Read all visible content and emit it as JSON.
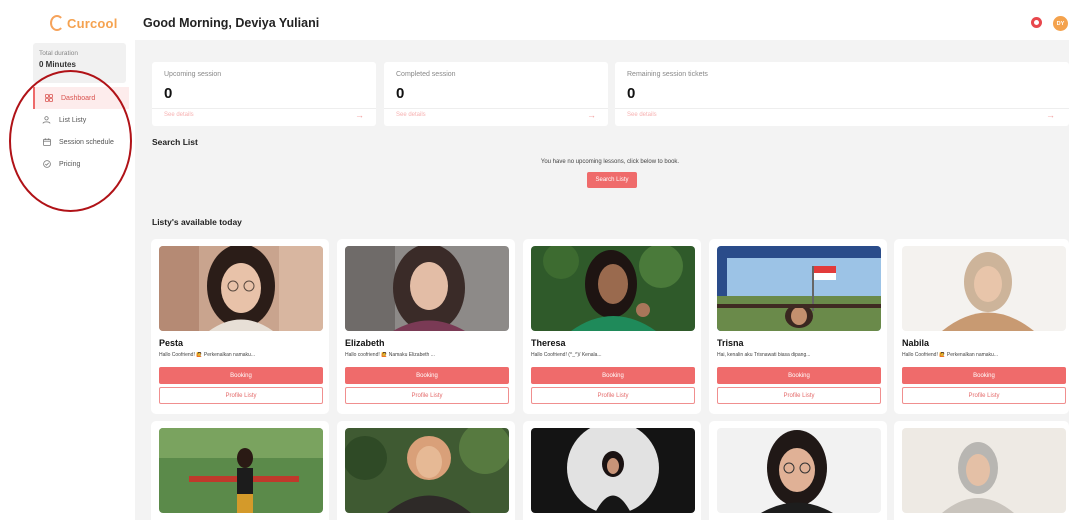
{
  "app": {
    "logo_text": "Curcool"
  },
  "sidebar": {
    "duration_label": "Total duration",
    "duration_value": "0 Minutes",
    "items": [
      {
        "label": "Dashboard",
        "icon": "grid-icon",
        "active": true
      },
      {
        "label": "List Listy",
        "icon": "users-icon",
        "active": false
      },
      {
        "label": "Session schedule",
        "icon": "calendar-icon",
        "active": false
      },
      {
        "label": "Pricing",
        "icon": "check-circle-icon",
        "active": false
      }
    ]
  },
  "header": {
    "greeting": "Good Morning, Deviya Yuliani",
    "avatar_initials": "DY",
    "notification_icon": "bell-icon"
  },
  "stats": [
    {
      "label": "Upcoming session",
      "value": "0",
      "link": "See details"
    },
    {
      "label": "Completed session",
      "value": "0",
      "link": "See details"
    },
    {
      "label": "Remaining session tickets",
      "value": "0",
      "link": "See details"
    }
  ],
  "search": {
    "title": "Search List",
    "empty_message": "You have no upcoming lessons, click below to book.",
    "button": "Search Listy"
  },
  "listy": {
    "title": "Listy's available today",
    "booking_label": "Booking",
    "profile_label": "Profile Listy",
    "cards": [
      {
        "name": "Pesta",
        "bio": "Hallo Coofriend! 🙋 Perkenalkan namaku..."
      },
      {
        "name": "Elizabeth",
        "bio": "Hallo coofriend! 🙋 Namaku Elizabeth ..."
      },
      {
        "name": "Theresa",
        "bio": "Hallo Coofriend! (^_^)/ Kenala..."
      },
      {
        "name": "Trisna",
        "bio": "Hai, kenalin aku Trisnawati biasa dipang..."
      },
      {
        "name": "Nabila",
        "bio": "Hallo Coofriend! 🙋 Perkenalkan namaku..."
      }
    ]
  },
  "colors": {
    "accent": "#ef6b6b",
    "brand": "#f5a24f",
    "annotation": "#b01217"
  }
}
